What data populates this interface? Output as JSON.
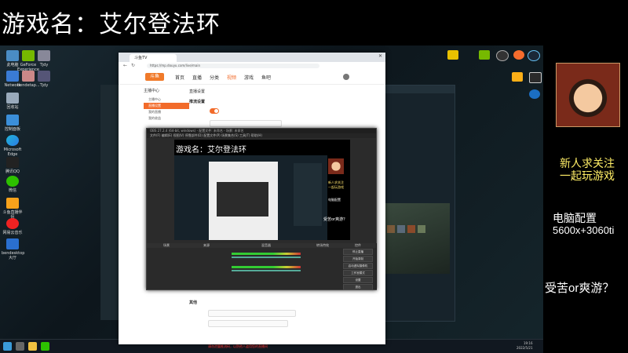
{
  "overlay": {
    "game_title": "游戏名：艾尔登法环",
    "follow_line1": "新人求关注",
    "follow_line2": "一起玩游戏",
    "pc_label": "电脑配置",
    "pc_spec": "5600x+3060ti",
    "question": "受苦or爽游？"
  },
  "desktop": {
    "icons_left": [
      "此电脑",
      "GeForce Experience",
      "Tjdy",
      "Network",
      "bendetap...",
      "Tjdy",
      "回收站",
      "",
      "控制面板",
      "Microsoft Edge",
      "腾讯QQ",
      "微信",
      "斗鱼直播伴侣",
      "网易云音乐",
      "bendesktop大厅"
    ],
    "icons_top_right": [
      "小黑盒",
      "NVIDIA Broadcast",
      "OBS Studio",
      "Origin",
      "Steam",
      "Rockstar Games Launcher",
      "Epic Games Launcher",
      "Uplay"
    ]
  },
  "browser": {
    "tab_title": "斗鱼TV",
    "url": "https://mp.douyu.com/live/main",
    "logo": "斗鱼",
    "nav": [
      "首页",
      "直播",
      "分类",
      "视频",
      "游戏",
      "鱼吧"
    ],
    "sidebar_head": "主播中心",
    "sidebar_items": [
      "主播中心",
      "直播设置",
      "我的直播",
      "我的收益"
    ],
    "section_title": "直播设置",
    "subsection": "推流设置",
    "other_section": "其他",
    "warning": "请勿泄露推流码，以防他人盗用您的直播间"
  },
  "obs": {
    "title": "OBS 27.2.4 (64-bit, windows) - 配置文件: 未命名 - 场景: 未命名",
    "menu": "文件(F)  编辑(E)  视图(V)  停靠部件(D)  配置文件(P)  场景集合(S)  工具(T)  帮助(H)",
    "preview_title": "游戏名：艾尔登法环",
    "preview_follow": "新人求关注",
    "preview_follow2": "一起玩游戏",
    "preview_pc": "电脑配置",
    "preview_question": "受苦or爽游？",
    "docks": [
      "场景",
      "来源",
      "混音器",
      "转场特效",
      "控件"
    ],
    "controls": [
      "停止直播",
      "开始录制",
      "启动虚拟摄像机",
      "工作室模式",
      "设置",
      "退出"
    ]
  },
  "taskbar": {
    "time": "19:16",
    "date": "2022/5/21"
  }
}
